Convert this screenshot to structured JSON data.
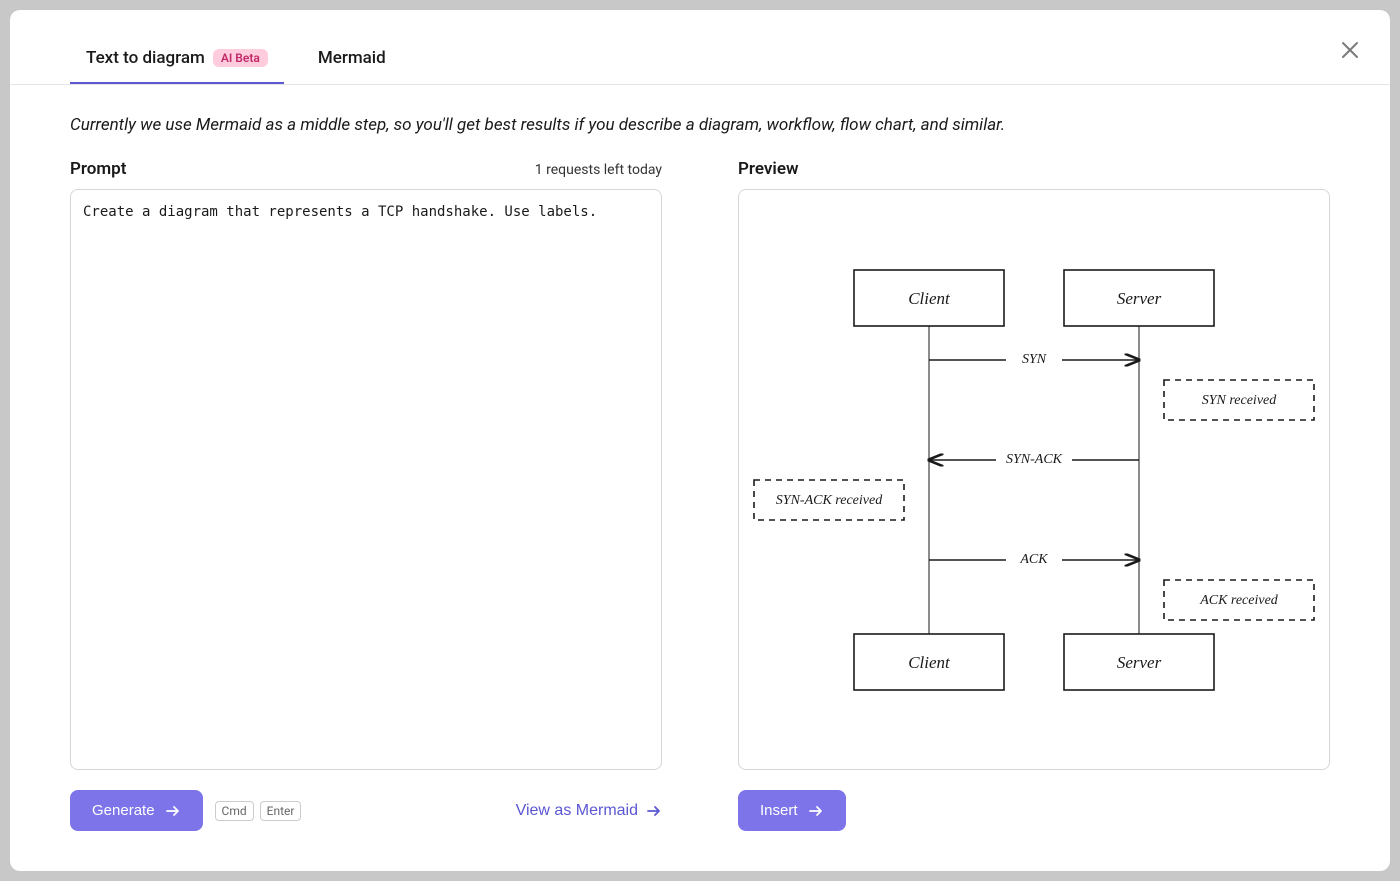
{
  "tabs": {
    "text_to_diagram": "Text to diagram",
    "badge": "AI Beta",
    "mermaid": "Mermaid"
  },
  "info": "Currently we use Mermaid as a middle step, so you'll get best results if you describe a diagram, workflow, flow chart, and similar.",
  "prompt": {
    "label": "Prompt",
    "requests_left": "1 requests left today",
    "value": "Create a diagram that represents a TCP handshake. Use labels."
  },
  "preview": {
    "label": "Preview"
  },
  "diagram": {
    "client_top": "Client",
    "server_top": "Server",
    "client_bottom": "Client",
    "server_bottom": "Server",
    "msg1": "SYN",
    "note1": "SYN received",
    "msg2": "SYN-ACK",
    "note2": "SYN-ACK received",
    "msg3": "ACK",
    "note3": "ACK received"
  },
  "buttons": {
    "generate": "Generate",
    "cmd": "Cmd",
    "enter": "Enter",
    "view_mermaid": "View as Mermaid",
    "insert": "Insert"
  }
}
